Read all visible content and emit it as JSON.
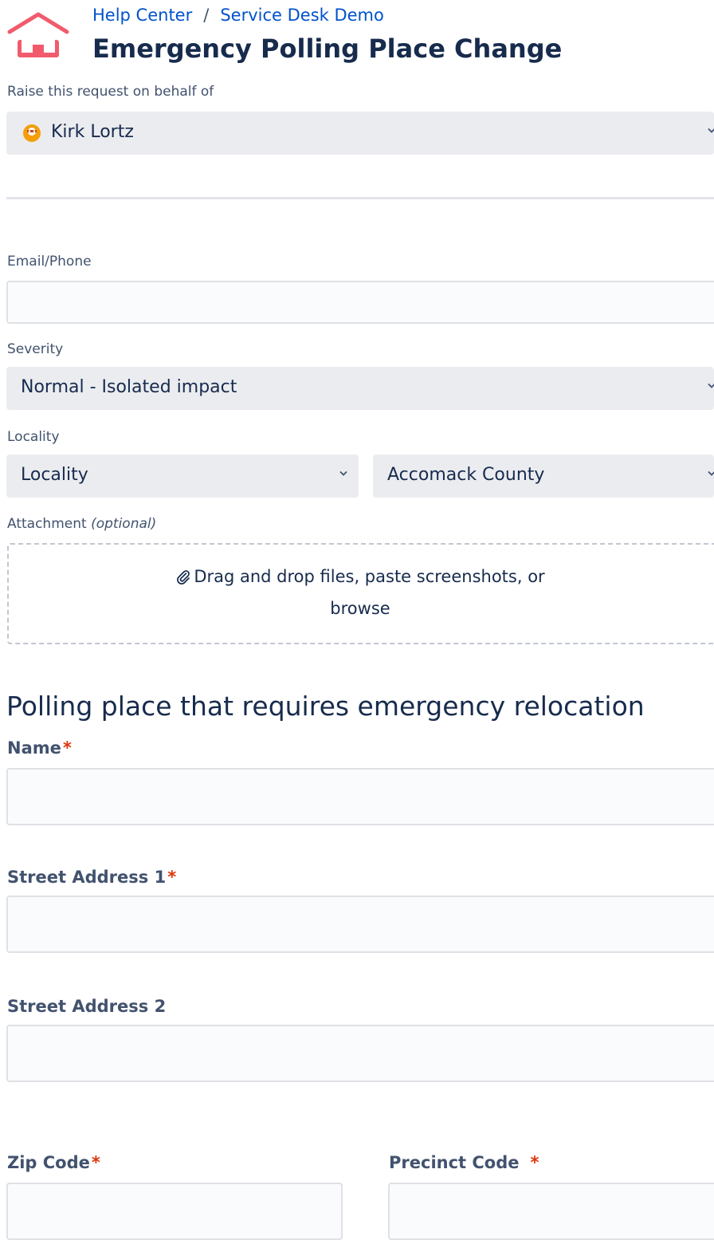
{
  "header": {
    "breadcrumb": [
      "Help Center",
      "Service Desk Demo"
    ],
    "breadcrumb_separator": "/",
    "title": "Emergency Polling Place Change",
    "logo_icon": "house-icon",
    "logo_color": "#f15b6c"
  },
  "on_behalf": {
    "label": "Raise this request on behalf of",
    "value": "Kirk Lortz",
    "avatar_icon": "user-avatar-icon"
  },
  "email_phone": {
    "label": "Email/Phone",
    "value": "",
    "placeholder": ""
  },
  "severity": {
    "label": "Severity",
    "value": "Normal - Isolated impact"
  },
  "locality": {
    "label": "Locality",
    "type_value": "Locality",
    "county_value": "Accomack County"
  },
  "attachment": {
    "label": "Attachment",
    "optional": "(optional)",
    "line1": "Drag and drop files, paste screenshots, or",
    "browse": "browse",
    "icon": "paperclip-icon"
  },
  "polling_section": {
    "heading": "Polling place that requires emergency relocation",
    "name_label": "Name",
    "street1_label": "Street Address 1",
    "street2_label": "Street Address 2",
    "zip_label": "Zip Code",
    "precinct_label": "Precinct Code",
    "required_marker": "*"
  },
  "colors": {
    "link": "#0052cc",
    "required": "#de350b",
    "select_bg": "#ebecf0",
    "input_bg": "#fafbfc"
  }
}
